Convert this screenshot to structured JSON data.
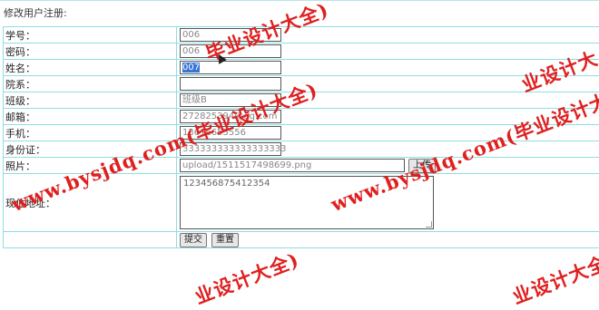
{
  "page": {
    "title": "修改用户注册:"
  },
  "form": {
    "student_id": {
      "label": "学号：",
      "value": "006"
    },
    "password": {
      "label": "密码：",
      "value": "006"
    },
    "name": {
      "label": "姓名：",
      "value": "007"
    },
    "department": {
      "label": "院系：",
      "value": ""
    },
    "class": {
      "label": "班级：",
      "value": "班级B"
    },
    "email": {
      "label": "邮箱：",
      "value": "272825394@qq.com"
    },
    "phone": {
      "label": "手机：",
      "value": "13616655556"
    },
    "id_card": {
      "label": "身份证：",
      "value": "333333333333333333"
    },
    "photo": {
      "label": "照片：",
      "value": "upload/1511517498699.png",
      "upload_label": "上传"
    },
    "address": {
      "label": "现住地址：",
      "value": "123456875412354"
    },
    "submit_label": "提交",
    "reset_label": "重置"
  },
  "watermark": {
    "text_left": "www.bysjdq.com(毕业设计大全)",
    "text_right": "www.bysjdq.com(毕业设计大全)",
    "text_top": "毕业设计大全)",
    "text_bottom_left": "业设计大全)",
    "text_bottom_right": "业设计大全)",
    "text_right_top": "业设计大",
    "color": "#e01f1f"
  }
}
